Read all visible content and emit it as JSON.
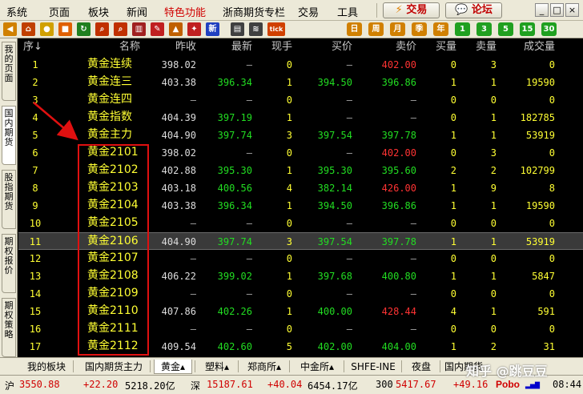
{
  "menu": {
    "items": [
      "系统",
      "页面",
      "板块",
      "新闻",
      "特色功能",
      "浙商期货专栏",
      "交易",
      "工具"
    ],
    "highlight_index": 4,
    "trade_button": "交易",
    "forum_button": "论坛",
    "window_controls": [
      "_",
      "□",
      "×"
    ]
  },
  "toolbar": {
    "icons": [
      {
        "name": "back-icon",
        "glyph": "◀",
        "color": "#d08000"
      },
      {
        "name": "home-icon",
        "glyph": "⌂",
        "color": "#c04000"
      },
      {
        "name": "coin-icon",
        "glyph": "●",
        "color": "#d0a000"
      },
      {
        "name": "book-icon",
        "glyph": "■",
        "color": "#e06000"
      },
      {
        "name": "refresh-icon",
        "glyph": "↻",
        "color": "#208020"
      },
      {
        "name": "search-icon",
        "glyph": "⌕",
        "color": "#c03000"
      },
      {
        "name": "search-code-icon",
        "glyph": "⌕",
        "color": "#c03000"
      },
      {
        "name": "chart-icon",
        "glyph": "▥",
        "color": "#a02020"
      },
      {
        "name": "pencil-icon",
        "glyph": "✎",
        "color": "#c02020"
      },
      {
        "name": "hat-icon",
        "glyph": "▲",
        "color": "#c06000"
      },
      {
        "name": "pin-icon",
        "glyph": "✦",
        "color": "#c02020"
      },
      {
        "name": "new-icon",
        "glyph": "新",
        "color": "#2040c0"
      },
      {
        "name": "table-view-icon",
        "glyph": "▤",
        "color": "#404040"
      },
      {
        "name": "kline-icon",
        "glyph": "≋",
        "color": "#404040"
      },
      {
        "name": "tick-icon",
        "glyph": "tick",
        "color": "#d04000"
      }
    ],
    "periods": [
      "日",
      "周",
      "月",
      "季",
      "年",
      "1",
      "3",
      "5",
      "15",
      "30"
    ]
  },
  "left_tabs": [
    {
      "label": "我的页面",
      "active": false
    },
    {
      "label": "国内期货",
      "active": true
    },
    {
      "label": "股指期货",
      "active": false
    },
    {
      "label": "期权报价",
      "active": false
    },
    {
      "label": "期权策略",
      "active": false
    }
  ],
  "columns": [
    "序",
    "名称",
    "昨收",
    "最新",
    "现手",
    "买价",
    "卖价",
    "买量",
    "卖量",
    "成交量"
  ],
  "sort_indicator": "↓",
  "rows": [
    {
      "seq": "1",
      "name": "黄金连续",
      "prev": "398.02",
      "last": "—",
      "hand": "0",
      "bid": "—",
      "ask": "402.00",
      "bidv": "0",
      "askv": "3",
      "vol": "0"
    },
    {
      "seq": "2",
      "name": "黄金连三",
      "prev": "403.38",
      "last": "396.34",
      "hand": "1",
      "bid": "394.50",
      "ask": "396.86",
      "bidv": "1",
      "askv": "1",
      "vol": "19590"
    },
    {
      "seq": "3",
      "name": "黄金连四",
      "prev": "—",
      "last": "—",
      "hand": "0",
      "bid": "—",
      "ask": "—",
      "bidv": "0",
      "askv": "0",
      "vol": "0"
    },
    {
      "seq": "4",
      "name": "黄金指数",
      "prev": "404.39",
      "last": "397.19",
      "hand": "1",
      "bid": "—",
      "ask": "—",
      "bidv": "0",
      "askv": "1",
      "vol": "182785"
    },
    {
      "seq": "5",
      "name": "黄金主力",
      "prev": "404.90",
      "last": "397.74",
      "hand": "3",
      "bid": "397.54",
      "ask": "397.78",
      "bidv": "1",
      "askv": "1",
      "vol": "53919"
    },
    {
      "seq": "6",
      "name": "黄金2101",
      "prev": "398.02",
      "last": "—",
      "hand": "0",
      "bid": "—",
      "ask": "402.00",
      "bidv": "0",
      "askv": "3",
      "vol": "0"
    },
    {
      "seq": "7",
      "name": "黄金2102",
      "prev": "402.88",
      "last": "395.30",
      "hand": "1",
      "bid": "395.30",
      "ask": "395.60",
      "bidv": "2",
      "askv": "2",
      "vol": "102799"
    },
    {
      "seq": "8",
      "name": "黄金2103",
      "prev": "403.18",
      "last": "400.56",
      "hand": "4",
      "bid": "382.14",
      "ask": "426.00",
      "bidv": "1",
      "askv": "9",
      "vol": "8"
    },
    {
      "seq": "9",
      "name": "黄金2104",
      "prev": "403.38",
      "last": "396.34",
      "hand": "1",
      "bid": "394.50",
      "ask": "396.86",
      "bidv": "1",
      "askv": "1",
      "vol": "19590"
    },
    {
      "seq": "10",
      "name": "黄金2105",
      "prev": "—",
      "last": "—",
      "hand": "0",
      "bid": "—",
      "ask": "—",
      "bidv": "0",
      "askv": "0",
      "vol": "0"
    },
    {
      "seq": "11",
      "name": "黄金2106",
      "prev": "404.90",
      "last": "397.74",
      "hand": "3",
      "bid": "397.54",
      "ask": "397.78",
      "bidv": "1",
      "askv": "1",
      "vol": "53919"
    },
    {
      "seq": "12",
      "name": "黄金2107",
      "prev": "—",
      "last": "—",
      "hand": "0",
      "bid": "—",
      "ask": "—",
      "bidv": "0",
      "askv": "0",
      "vol": "0"
    },
    {
      "seq": "13",
      "name": "黄金2108",
      "prev": "406.22",
      "last": "399.02",
      "hand": "1",
      "bid": "397.68",
      "ask": "400.80",
      "bidv": "1",
      "askv": "1",
      "vol": "5847"
    },
    {
      "seq": "14",
      "name": "黄金2109",
      "prev": "—",
      "last": "—",
      "hand": "0",
      "bid": "—",
      "ask": "—",
      "bidv": "0",
      "askv": "0",
      "vol": "0"
    },
    {
      "seq": "15",
      "name": "黄金2110",
      "prev": "407.86",
      "last": "402.26",
      "hand": "1",
      "bid": "400.00",
      "ask": "428.44",
      "bidv": "4",
      "askv": "1",
      "vol": "591"
    },
    {
      "seq": "16",
      "name": "黄金2111",
      "prev": "—",
      "last": "—",
      "hand": "0",
      "bid": "—",
      "ask": "—",
      "bidv": "0",
      "askv": "0",
      "vol": "0"
    },
    {
      "seq": "17",
      "name": "黄金2112",
      "prev": "409.54",
      "last": "402.60",
      "hand": "5",
      "bid": "402.00",
      "ask": "404.00",
      "bidv": "1",
      "askv": "2",
      "vol": "31"
    }
  ],
  "selected_row": 11,
  "colors": {
    "up": "#ff3333",
    "down": "#22dd22",
    "accent": "#ffff33",
    "highlight_box": "#e01010"
  },
  "bottom_tabs": [
    {
      "label": "我的板块",
      "active": false
    },
    {
      "label": "国内期货主力",
      "active": false
    },
    {
      "label": "黄金▴",
      "active": true
    },
    {
      "label": "塑料▴",
      "active": false
    },
    {
      "label": "郑商所▴",
      "active": false
    },
    {
      "label": "中金所▴",
      "active": false
    },
    {
      "label": "SHFE-INE",
      "active": false
    },
    {
      "label": "夜盘",
      "active": false
    },
    {
      "label": "国内期货",
      "active": false
    }
  ],
  "status": {
    "sh_label": "沪",
    "sh_index": "3550.88",
    "sh_change": "+22.20",
    "sh_amount": "5218.20亿",
    "sz_label": "深",
    "sz_index": "15187.61",
    "sz_change": "+40.04",
    "sz_amount": "6454.17亿",
    "cy_label": "300",
    "cy_index": "5417.67",
    "cy_change": "+49.16",
    "brand": "Pobo",
    "time": "08:44"
  },
  "watermark": "知乎 @跳豆豆"
}
